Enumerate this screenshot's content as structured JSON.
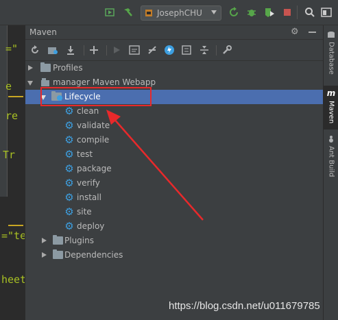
{
  "toolbar": {
    "run_config": "JosephCHU",
    "icons": [
      "build-hammer-icon",
      "run-config-icon",
      "rerun-icon",
      "debug-bug-icon",
      "run-coverage-icon",
      "stop-icon",
      "search-icon",
      "ide-window-icon"
    ]
  },
  "editor": {
    "lines": [
      "=\"",
      "e",
      "re",
      "Tr",
      "=\"te",
      "heet\""
    ]
  },
  "maven": {
    "title": "Maven",
    "toolbar_icons": [
      "reimport-icon",
      "generate-sources-icon",
      "download-icon",
      "add-icon",
      "run-icon",
      "execute-goal-icon",
      "toggle-offline-icon",
      "skip-tests-icon",
      "show-dependencies-icon",
      "collapse-icon",
      "settings-wrench-icon"
    ],
    "tree": [
      {
        "label": "Profiles",
        "level": 0,
        "expanded": false,
        "icon": "folder-icon"
      },
      {
        "label": "manager Maven Webapp",
        "level": 0,
        "expanded": true,
        "icon": "maven-project-icon"
      },
      {
        "label": "Lifecycle",
        "level": 1,
        "expanded": true,
        "selected": true,
        "icon": "folder-gear-icon"
      },
      {
        "label": "clean",
        "level": 2,
        "icon": "goal-gear-icon"
      },
      {
        "label": "validate",
        "level": 2,
        "icon": "goal-gear-icon"
      },
      {
        "label": "compile",
        "level": 2,
        "icon": "goal-gear-icon"
      },
      {
        "label": "test",
        "level": 2,
        "icon": "goal-gear-icon"
      },
      {
        "label": "package",
        "level": 2,
        "icon": "goal-gear-icon"
      },
      {
        "label": "verify",
        "level": 2,
        "icon": "goal-gear-icon"
      },
      {
        "label": "install",
        "level": 2,
        "icon": "goal-gear-icon"
      },
      {
        "label": "site",
        "level": 2,
        "icon": "goal-gear-icon"
      },
      {
        "label": "deploy",
        "level": 2,
        "icon": "goal-gear-icon"
      },
      {
        "label": "Plugins",
        "level": 1,
        "expanded": false,
        "icon": "folder-icon"
      },
      {
        "label": "Dependencies",
        "level": 1,
        "expanded": false,
        "icon": "folder-icon"
      }
    ]
  },
  "right_tabs": [
    {
      "label": "Database",
      "icon": "database-icon"
    },
    {
      "label": "Maven",
      "icon": "maven-m-icon",
      "active": true
    },
    {
      "label": "Ant Build",
      "icon": "ant-icon"
    }
  ],
  "watermark": "https://blog.csdn.net/u011679785",
  "colors": {
    "selection": "#4b6eaf",
    "annotation": "#e8292b",
    "goal_icon": "#3d9fe0"
  }
}
